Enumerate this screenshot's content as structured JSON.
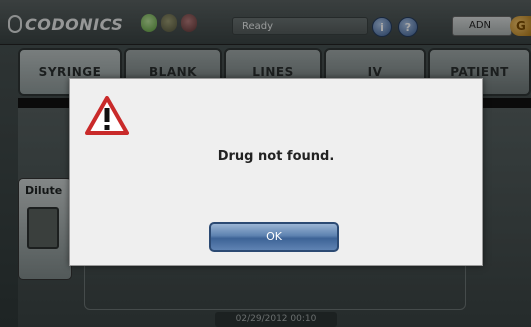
{
  "header": {
    "logo_text": "CODONICS",
    "status_text": "Ready",
    "help_button_glyph": "?",
    "user_label": "ADN",
    "logout_glyph": "G"
  },
  "tabs": [
    {
      "label": "SYRINGE",
      "active": true
    },
    {
      "label": "BLANK",
      "active": false
    },
    {
      "label": "LINES",
      "active": false
    },
    {
      "label": "IV",
      "active": false
    },
    {
      "label": "PATIENT",
      "active": false
    }
  ],
  "main": {
    "dilute_label": "Dilute",
    "datetime": "02/29/2012 00:10"
  },
  "dialog": {
    "icon": "warning-icon",
    "message": "Drug not found.",
    "ok_label": "OK"
  },
  "colors": {
    "status_led_ready": "#6fbf4a",
    "ok_button": "#4a6fa0"
  }
}
